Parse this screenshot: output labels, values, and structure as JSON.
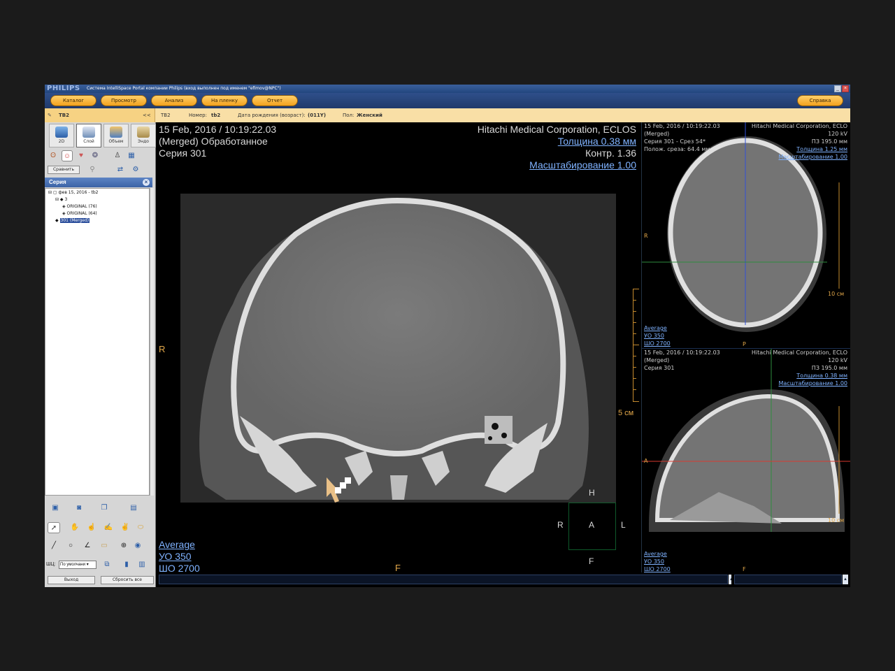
{
  "window": {
    "brand": "PHILIPS",
    "title": "Система IntelliSpace Portal компании Philips (вход выполнен под именем \"efimov@NPC\")"
  },
  "menu": {
    "items": [
      "Каталог",
      "Просмотр",
      "Анализ",
      "На пленку",
      "Отчет"
    ],
    "help": "Справка"
  },
  "patient": {
    "tab": "ТВ2",
    "collapse": "<<",
    "name": "ТВ2",
    "number_label": "Номер:",
    "number": "tb2",
    "dob_label": "Дата рождения (возраст):",
    "dob": "(011Y)",
    "sex_label": "Пол:",
    "sex": "Женский"
  },
  "left": {
    "modes": [
      "2D",
      "Слой",
      "Объем",
      "Эндо"
    ],
    "compare": "Сравнить",
    "series_title": "Серия",
    "tree": {
      "study": "фев 15, 2016 - tb2",
      "node3": "3",
      "orig76": "ORIGINAL (76)",
      "orig64": "ORIGINAL (64)",
      "merged": "301 (Merged)"
    },
    "wl_label": "ШЦ:",
    "wl_value": "По умолчани",
    "exit": "Выход",
    "reset": "Сбросить все"
  },
  "main": {
    "datetime": "15 Feb, 2016 / 10:19:22.03",
    "desc": "(Merged) Обработанное",
    "series": "Серия 301",
    "manufacturer": "Hitachi Medical Corporation, ECLOS",
    "thickness": "Толщина 0.38 мм",
    "contrast": "Контр. 1.36",
    "zoom": "Масштабирование 1.00",
    "avg": "Average",
    "wl": "УО   350",
    "ww": "ШО  2700",
    "scale": "5 см",
    "left_marker": "R",
    "bottom_marker": "F",
    "orient": {
      "h": "H",
      "r": "R",
      "a": "A",
      "l": "L",
      "f": "F"
    }
  },
  "axial": {
    "datetime": "15 Feb, 2016 / 10:19:22.03",
    "desc": "(Merged)",
    "series": "Серия 301 - Срез 54*",
    "position": "Полож. среза: 64.4 мм",
    "manufacturer": "Hitachi Medical Corporation, ECLO",
    "kv": "120 kV",
    "fov": "ПЗ 195.0 мм",
    "thickness": "Толщина 1.25 мм",
    "zoom": "Масштабирование 1.00",
    "avg": "Average",
    "wl": "УО   350",
    "ww": "ШО  2700",
    "scale": "10 см",
    "left_marker": "R",
    "bottom_marker": "P"
  },
  "sagittal": {
    "datetime": "15 Feb, 2016 / 10:19:22.03",
    "desc": "(Merged)",
    "series": "Серия 301",
    "manufacturer": "Hitachi Medical Corporation, ECLO",
    "kv": "120 kV",
    "fov": "ПЗ 195.0 мм",
    "thickness": "Толщина 0.38 мм",
    "zoom": "Масштабирование 1.00",
    "avg": "Average",
    "wl": "УО   350",
    "ww": "ШО  2700",
    "scale": "10 см",
    "left_marker": "A",
    "bottom_marker": "F"
  },
  "colors": {
    "menu_pill": "#f3a21e",
    "overlay_link": "#7fb2ff",
    "crosshair_v": "#2f4fd8",
    "crosshair_h": "#2e8b3e",
    "crosshair_red": "#d83a2f"
  }
}
